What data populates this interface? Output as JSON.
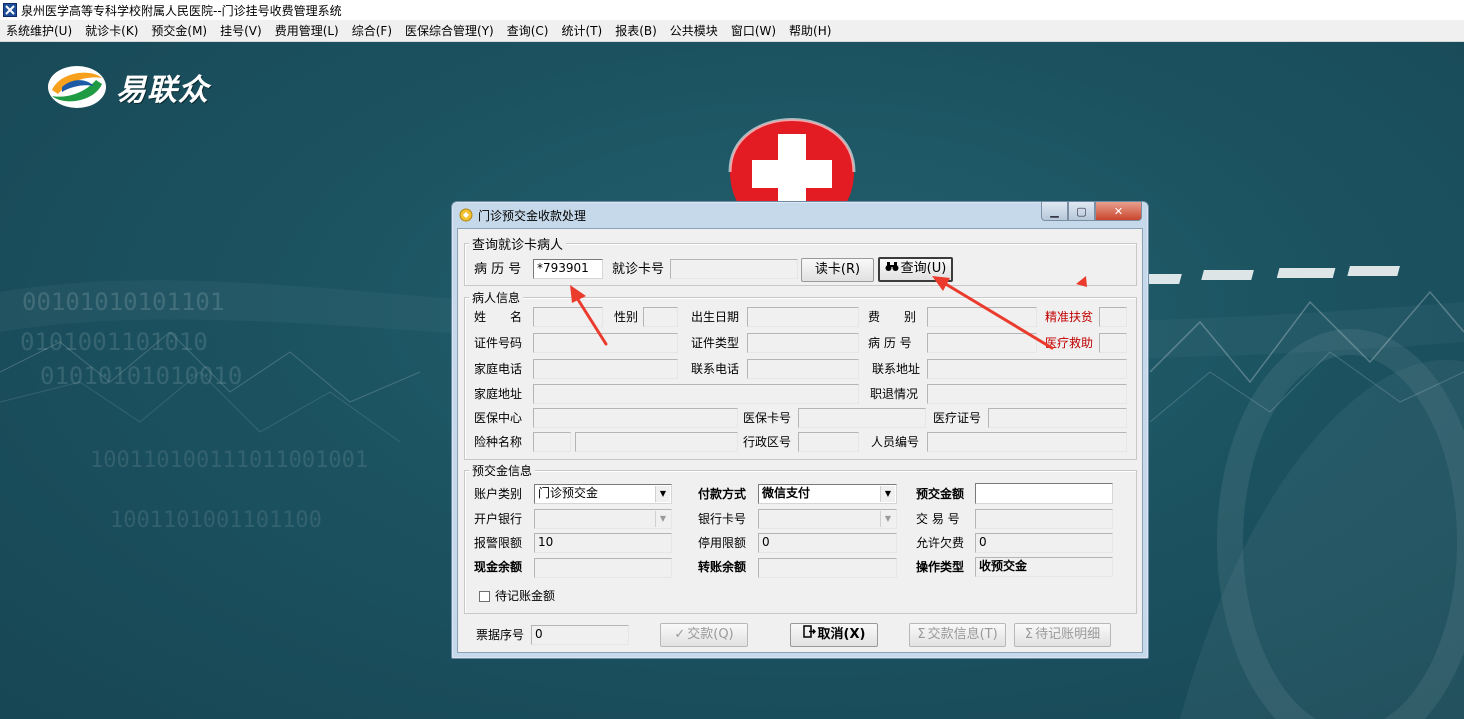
{
  "app": {
    "title": "泉州医学高等专科学校附属人民医院--门诊挂号收费管理系统"
  },
  "menu": [
    "系统维护(U)",
    "就诊卡(K)",
    "预交金(M)",
    "挂号(V)",
    "费用管理(L)",
    "综合(F)",
    "医保综合管理(Y)",
    "查询(C)",
    "统计(T)",
    "报表(B)",
    "公共模块",
    "窗口(W)",
    "帮助(H)"
  ],
  "logo": {
    "text": "易联众"
  },
  "backdrop": {
    "binary_lines": [
      "00101010101101",
      "0101001101010",
      "01010101010010",
      "100110100111011001001",
      "1001101001101100"
    ]
  },
  "dialog": {
    "title": "门诊预交金收款处理",
    "query_group": {
      "title": "查询就诊卡病人",
      "record_no_label": "病 历 号",
      "record_no_value": "*793901",
      "card_no_label": "就诊卡号",
      "card_no_value": "",
      "read_card_button": "读卡(R)",
      "query_button": "查询(U)"
    },
    "patient_group": {
      "title": "病人信息",
      "name_label": "姓　　名",
      "gender_label": "性别",
      "birth_label": "出生日期",
      "fee_type_label": "费　　别",
      "poverty_label": "精准扶贫",
      "id_no_label": "证件号码",
      "id_type_label": "证件类型",
      "record_no_label": "病 历 号",
      "medical_aid_label": "医疗救助",
      "home_phone_label": "家庭电话",
      "contact_phone_label": "联系电话",
      "contact_addr_label": "联系地址",
      "home_addr_label": "家庭地址",
      "retire_label": "职退情况",
      "insurance_center_label": "医保中心",
      "insurance_card_label": "医保卡号",
      "medical_cert_label": "医疗证号",
      "insurance_type_label": "险种名称",
      "district_label": "行政区号",
      "staff_no_label": "人员编号"
    },
    "deposit_group": {
      "title": "预交金信息",
      "account_type_label": "账户类别",
      "account_type_value": "门诊预交金",
      "pay_method_label": "付款方式",
      "pay_method_value": "微信支付",
      "deposit_amount_label": "预交金额",
      "deposit_amount_value": "",
      "bank_label": "开户银行",
      "bank_card_label": "银行卡号",
      "trade_no_label": "交 易 号",
      "alarm_limit_label": "报警限额",
      "alarm_limit_value": "10",
      "stop_limit_label": "停用限额",
      "stop_limit_value": "0",
      "allow_debt_label": "允许欠费",
      "allow_debt_value": "0",
      "cash_balance_label": "现金余额",
      "transfer_balance_label": "转账余额",
      "op_type_label": "操作类型",
      "op_type_value": "收预交金",
      "pending_checkbox_label": "待记账金额"
    },
    "footer": {
      "receipt_no_label": "票据序号",
      "receipt_no_value": "0",
      "pay_button": "交款(Q)",
      "cancel_button": "取消(X)",
      "pay_info_button": "交款信息(T)",
      "pending_detail_button": "待记账明细"
    }
  },
  "colors": {
    "backdrop": "#1c5361",
    "dialog_frame": "#c6d9ea",
    "annotation_arrow": "#ea3b2c",
    "warning_label": "#c00000"
  }
}
